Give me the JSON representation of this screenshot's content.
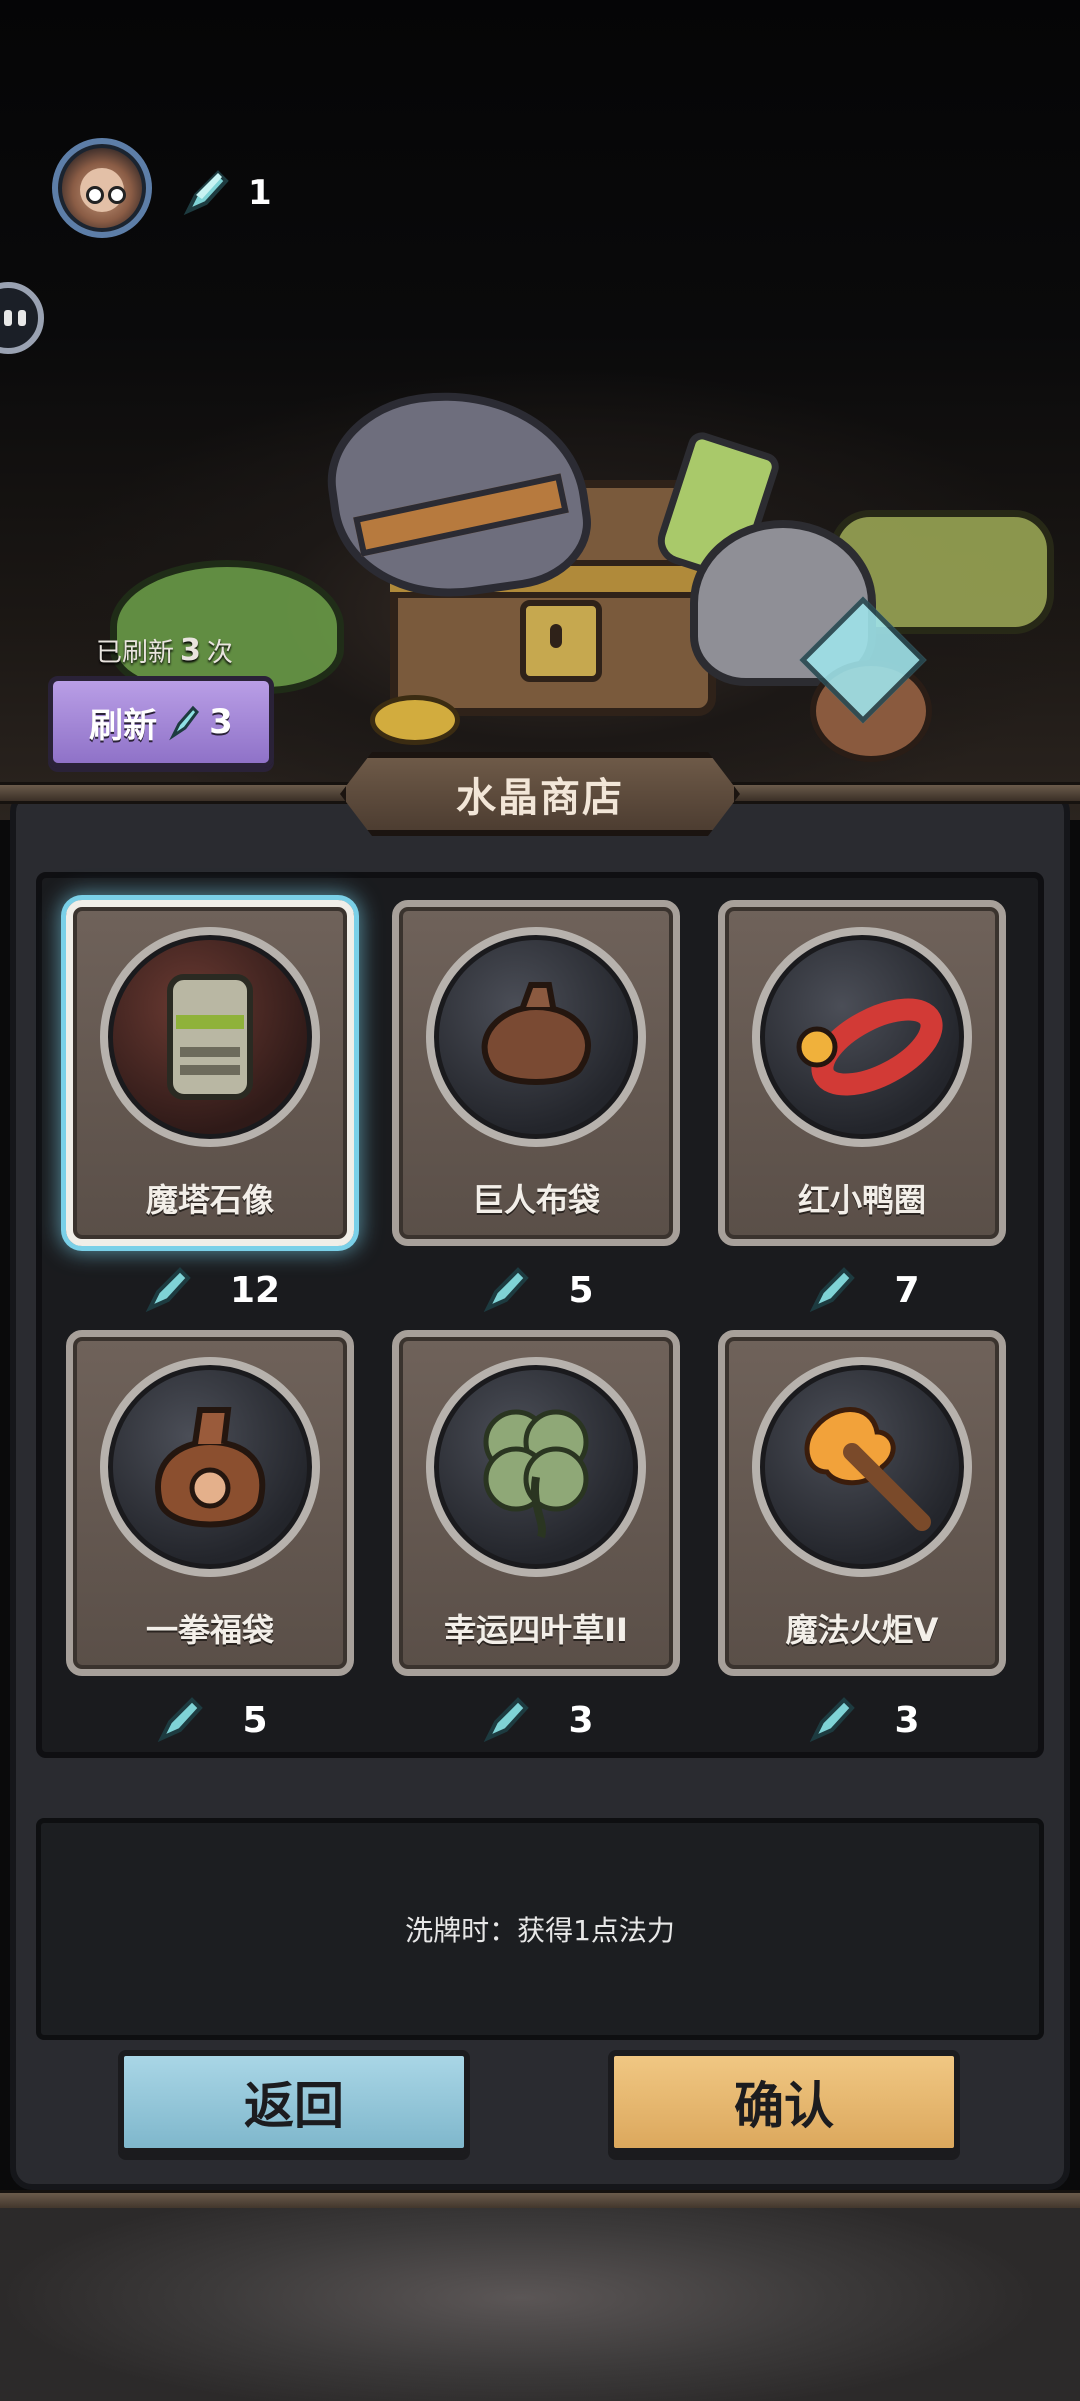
{
  "hud": {
    "crystal_count": "1"
  },
  "shop": {
    "refresh_prefix": "已刷新",
    "refresh_times": "3",
    "refresh_suffix": "次",
    "refresh_label": "刷新",
    "refresh_cost": "3",
    "title": "水晶商店",
    "selected_index": 0
  },
  "items": [
    {
      "name": "魔塔石像",
      "price": "12",
      "icon": "tiki-statue-icon"
    },
    {
      "name": "巨人布袋",
      "price": "5",
      "icon": "sack-icon"
    },
    {
      "name": "红小鸭圈",
      "price": "7",
      "icon": "duck-float-icon"
    },
    {
      "name": "一拳福袋",
      "price": "5",
      "icon": "fist-bag-icon"
    },
    {
      "name": "幸运四叶草II",
      "price": "3",
      "icon": "four-leaf-clover-icon"
    },
    {
      "name": "魔法火炬V",
      "price": "3",
      "icon": "magic-torch-icon"
    }
  ],
  "description": "洗牌时：获得1点法力",
  "buttons": {
    "back": "返回",
    "confirm": "确认"
  },
  "colors": {
    "crystal": "#7fd3d6",
    "refresh_button": "#a98bd9",
    "back_button": "#8fc5d8",
    "confirm_button": "#e7b76b",
    "selection_glow": "#7ad0e8"
  }
}
